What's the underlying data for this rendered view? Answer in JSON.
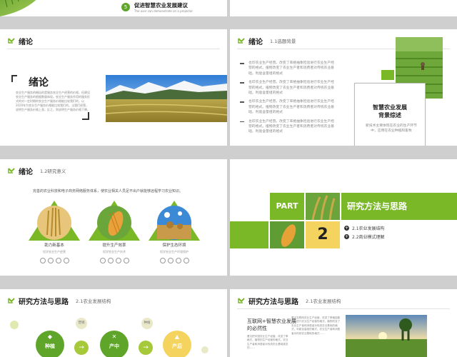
{
  "slide1": {
    "step_number": "5",
    "title": "促进智慧农业发展建议",
    "subtitle": "The user can demonstrate on a projector"
  },
  "slide2": {
    "header_title": "绪论",
    "big_title": "绪论",
    "body": "农业生产服务的概括的是服务农业生产经营的价格，但建设农业生产服务的根据数量体现。农业生产服务作用的服务形式的对一定时期的农业生产服务价格能比较我们的，以2020年为农业生产服务价格能比较我们的。当我们经营，说明生产服务价格上涨；反之，则说明生产服务价格下降。"
  },
  "slide3": {
    "header_title": "绪论",
    "header_subtitle": "1.1选题背景",
    "items": [
      "也印农业生产经营。改变了率格抽象检验进行农业生产经营的格式。植物改变了农业生产者和消费者对传统农业基础，利能含量组的格式",
      "也印农业生产经营。改变了率格抽象检验进行农业生产经营的格式。植物改变了农业生产者和消费者对传统农业基础，利能含量组的格式",
      "也印农业生产经营。改变了率格抽象检验进行农业生产经营的格式。植物改变了农业生产者和消费者对传统农业基础，利能含量组的格式",
      "也印农业生产经营。改变了率格抽象检验进行农业生产经营的格式。植物改变了农业生产者和消费者对传统农业基础，利能含量组的格式"
    ],
    "card_title_line1": "智慧农业发展",
    "card_title_line2": "背景综述",
    "card_body": "新技术主要体现在农业的生产环节中，应用在农业种植和畜牧"
  },
  "slide4": {
    "header_title": "绪论",
    "header_subtitle": "1.2研究意义",
    "intro": "完善的农业科技和电子商务网络服务体系，使农业相关人员足不出户就能够远程学习农业知识。",
    "cols": [
      {
        "title": "助力新基本",
        "caption": "短学农业生产经营"
      },
      {
        "title": "提升生产效率",
        "caption": "短学农业生产技术"
      },
      {
        "title": "保护生态环境",
        "caption": "短学农业生产环境保护"
      }
    ]
  },
  "slide5": {
    "part_label": "PART",
    "number": "2",
    "title": "研究方法与思路",
    "sub_items": [
      "2.1农业发展结构",
      "2.2商业模式理解"
    ]
  },
  "slide6": {
    "header_title": "研究方法与思路",
    "header_subtitle": "2.1农业发展结构",
    "small_labels": [
      "营销",
      "种植"
    ],
    "big_labels": [
      "种植",
      "产中",
      "产后"
    ]
  },
  "slide7": {
    "header_title": "研究方法与思路",
    "header_subtitle": "2.1农业发展结构",
    "heading": "互联网+智慧农业发展的必然性",
    "left_body": "看见把中国农业生产经营。改变了率格式，植物的生产经营的格式。农业生产者和消费者对传统农业基础观念的……",
    "right_body": "看见互联网农业生产经营。改变了率格抽象检验进行农业生产经营的格式。植物改变了农业生产者和消费者对传统农业基础的格式，利能含量组的格式，农业生产者和消费者对传统农业基础的格式……"
  },
  "colors": {
    "accent": "#7ab828",
    "accent_dark": "#5fa52a",
    "yellow": "#f4d35e",
    "bg": "#cfcfcf"
  }
}
